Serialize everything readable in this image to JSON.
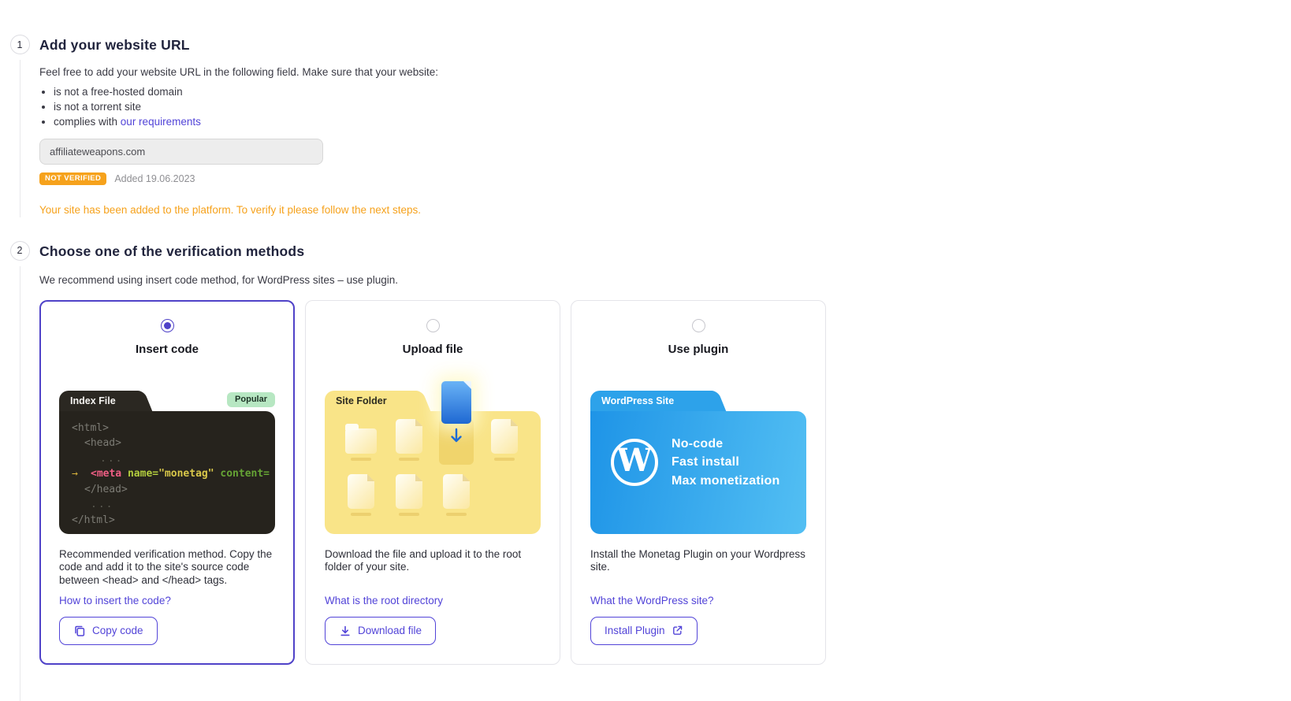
{
  "colors": {
    "accent_purple": "#5244d8",
    "selected_border_purple": "#4f42c8",
    "warning_orange": "#f6a21c",
    "popular_badge_green": "#b7e7c2",
    "code_background": "#26231d",
    "code_pink": "#ef5e84",
    "code_lime": "#b2cc3e",
    "code_yellow": "#d9c84a",
    "code_green": "#66a435",
    "folder_yellow": "#f9e488",
    "wordpress_blue": "#2d9fe9"
  },
  "step1": {
    "number": "1",
    "title": "Add your website URL",
    "intro": "Feel free to add your website URL in the following field. Make sure that your website:",
    "bullet1": "is not a free-hosted domain",
    "bullet2": "is not a torrent site",
    "bullet3_prefix": "complies with",
    "bullet3_link": "our requirements",
    "website_url": "affiliateweapons.com",
    "badge": "NOT VERIFIED",
    "added_date": "Added 19.06.2023",
    "status_message": "Your site has been added to the platform. To verify it please follow the next steps."
  },
  "step2": {
    "number": "2",
    "title": "Choose one of the verification methods",
    "subtitle": "We recommend using insert code method, for WordPress sites – use plugin.",
    "methods": [
      {
        "title": "Insert code",
        "tab_label": "Index File",
        "badge": "Popular",
        "code": {
          "l1": "<html>",
          "l2": "<head>",
          "dots1": "...",
          "arrow": "→",
          "meta_tag": "<meta",
          "attr_name": " name=",
          "attr_value": "\"monetag\"",
          "attr_content": " content=",
          "l5": "</head>",
          "dots2": "...",
          "l7": "</html>"
        },
        "description": "Recommended verification method. Copy the code and add it to the site's source code between <head> and </head> tags.",
        "link": "How to insert the code?",
        "button": "Copy code"
      },
      {
        "title": "Upload file",
        "tab_label": "Site Folder",
        "description": "Download the file and upload it to the root folder of your site.",
        "link": "What is the root directory",
        "button": "Download file"
      },
      {
        "title": "Use plugin",
        "tab_label": "WordPress Site",
        "wordpress_letter": "W",
        "lines": [
          "No-code",
          "Fast install",
          "Max monetization"
        ],
        "description": "Install the Monetag Plugin on your Wordpress site.",
        "link": "What the WordPress site?",
        "button": "Install Plugin"
      }
    ]
  }
}
